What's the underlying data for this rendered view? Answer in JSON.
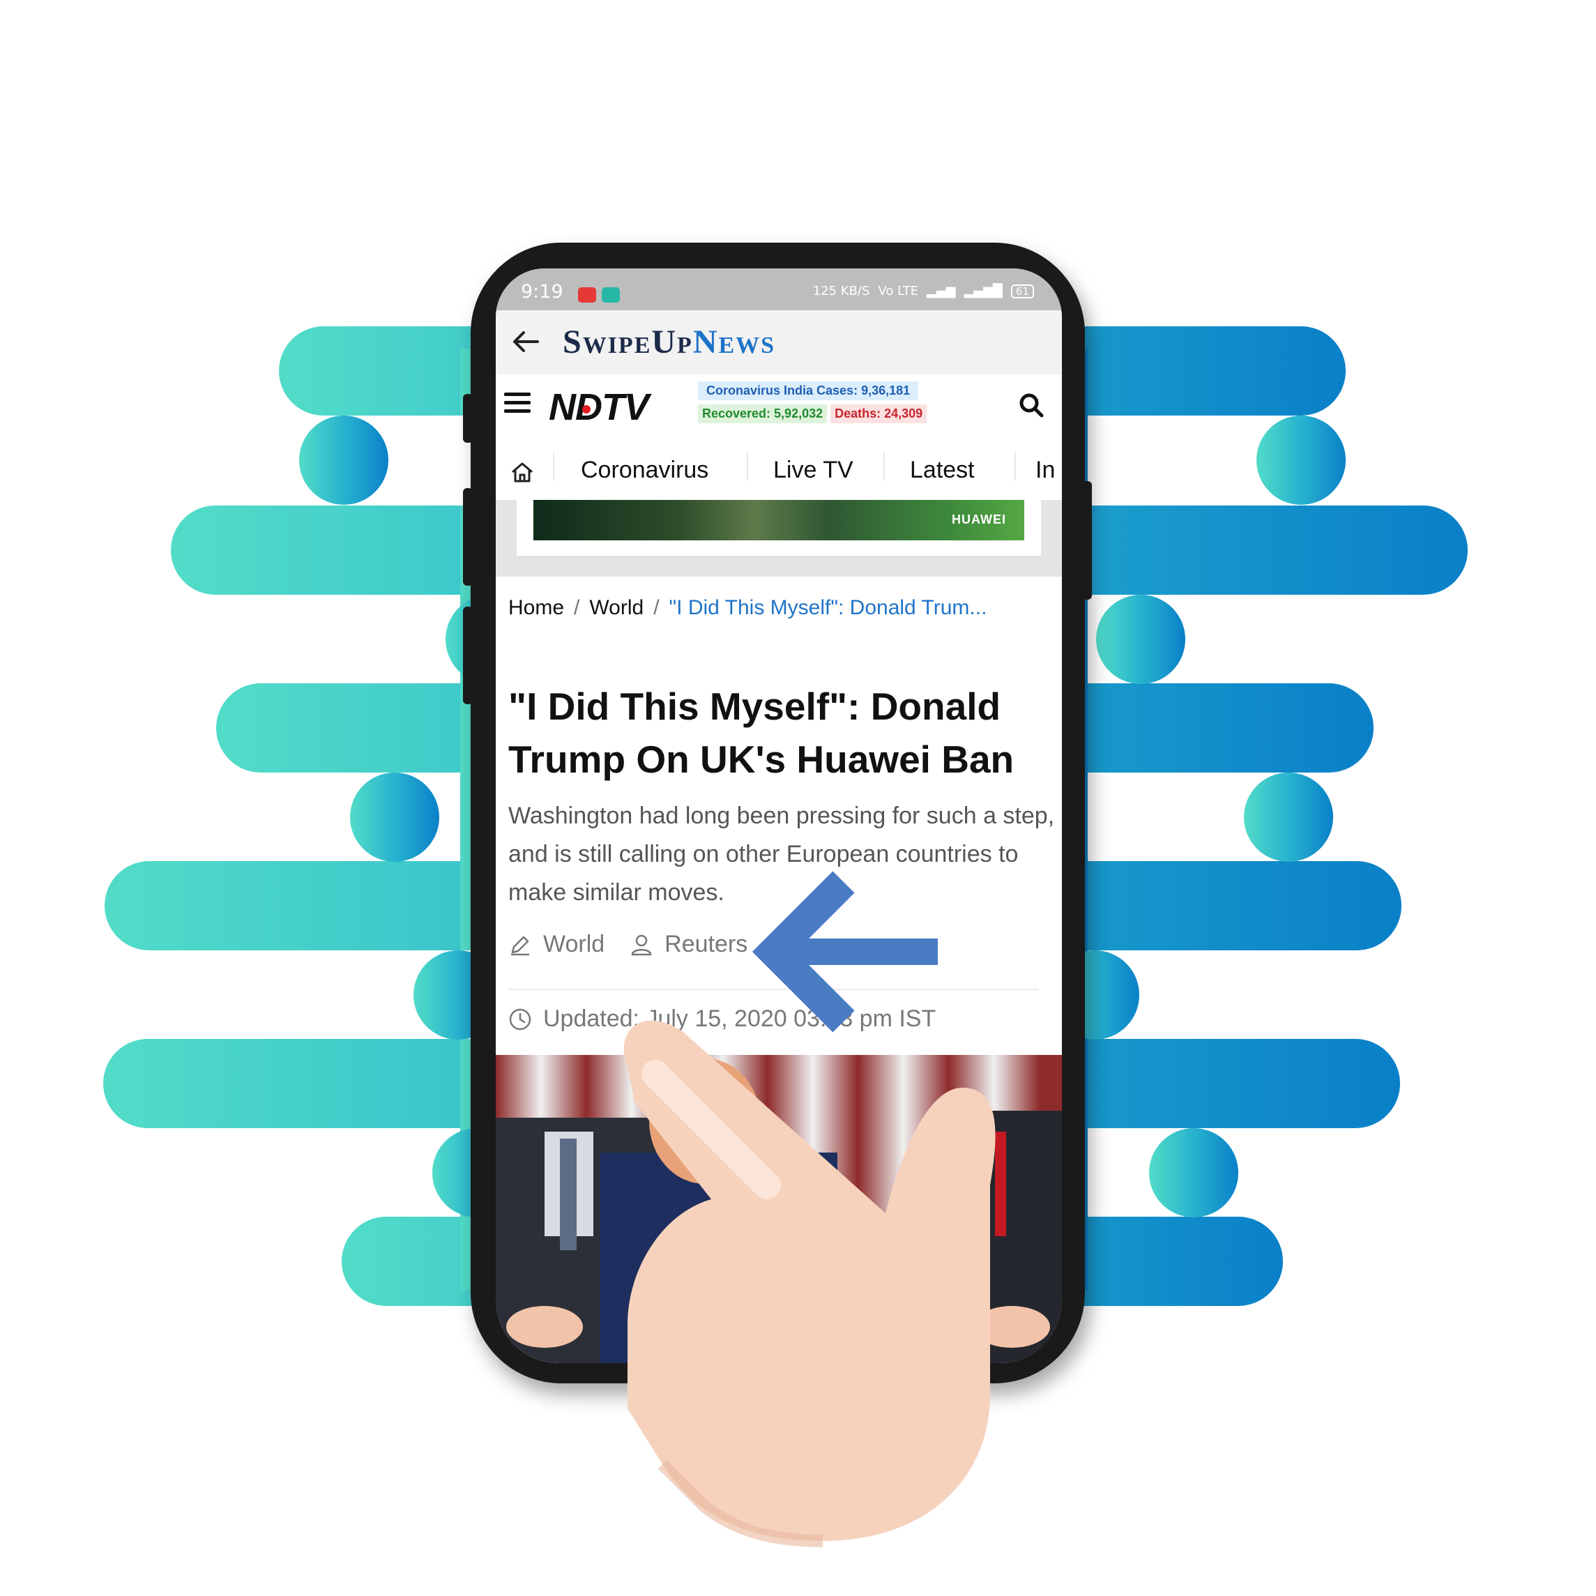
{
  "status_bar": {
    "time": "9:19",
    "network": "125 KB/S",
    "volte": "Vo LTE",
    "battery": "61"
  },
  "app_bar": {
    "brand_part1": "SwipeUp",
    "brand_part2": "News",
    "brand_colors": {
      "dark": "#1c2a4a",
      "accent": "#1e73c8"
    }
  },
  "site_header": {
    "logo_text": "NDTV",
    "covid_cases": "Coronavirus India Cases: 9,36,181",
    "covid_recovered": "Recovered: 5,92,032",
    "covid_deaths": "Deaths: 24,309",
    "menu_icon": "hamburger-icon",
    "search_icon": "search-icon"
  },
  "nav": {
    "home_icon": "home-icon",
    "items": [
      "Coronavirus",
      "Live TV",
      "Latest",
      "In"
    ]
  },
  "ad": {
    "brand": "HUAWEI"
  },
  "breadcrumb": {
    "home": "Home",
    "section": "World",
    "current": "\"I Did This Myself\": Donald Trum..."
  },
  "article": {
    "headline": "\"I Did This Myself\": Donald Trump On UK's Huawei Ban",
    "dek": "Washington had long been pressing for such a step, and is still calling on other European countries to make similar moves.",
    "category": "World",
    "author": "Reuters",
    "updated": "Updated: July 15, 2020 03:33 pm IST"
  },
  "gesture": {
    "arrow_color": "#4a7cc4",
    "hand_color": "#f6d2bd",
    "arrow_icon": "swipe-left-arrow-icon",
    "hand_icon": "pointing-hand-icon"
  }
}
